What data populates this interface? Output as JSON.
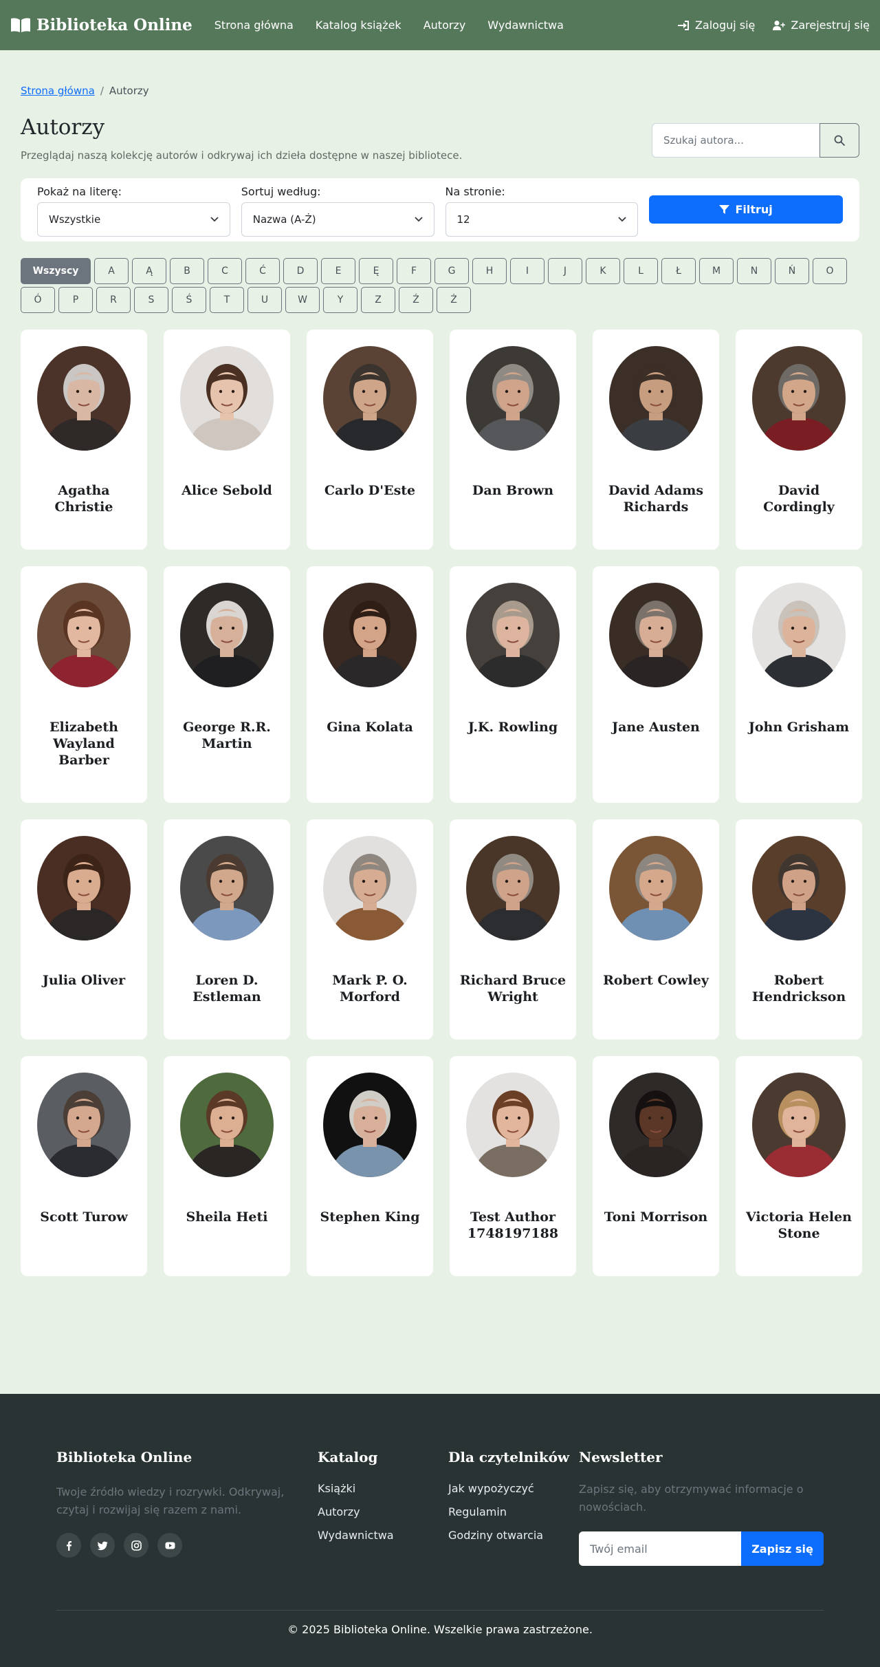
{
  "navbar": {
    "brand": "Biblioteka Online",
    "brand_icon": "book-open-icon",
    "links": [
      "Strona główna",
      "Katalog książek",
      "Autorzy",
      "Wydawnictwa"
    ],
    "login": "Zaloguj się",
    "register": "Zarejestruj się",
    "bg_color": "#55785a"
  },
  "breadcrumb": {
    "home": "Strona główna",
    "separator": "/",
    "current": "Autorzy"
  },
  "page": {
    "title": "Autorzy",
    "subtitle": "Przeglądaj naszą kolekcję autorów i odkrywaj ich dzieła dostępne w naszej bibliotece.",
    "search_placeholder": "Szukaj autora..."
  },
  "filters": {
    "letter_label": "Pokaż na literę:",
    "letter_value": "Wszystkie",
    "sort_label": "Sortuj według:",
    "sort_value": "Nazwa (A-Ż)",
    "per_page_label": "Na stronie:",
    "per_page_value": "12",
    "submit": "Filtruj",
    "accent_color": "#0d6efd"
  },
  "letters": {
    "all": "Wszyscy",
    "items": [
      "A",
      "Ą",
      "B",
      "C",
      "Ć",
      "D",
      "E",
      "Ę",
      "F",
      "G",
      "H",
      "I",
      "J",
      "K",
      "L",
      "Ł",
      "M",
      "N",
      "Ń",
      "O",
      "Ó",
      "P",
      "R",
      "S",
      "Ś",
      "T",
      "U",
      "W",
      "Y",
      "Z",
      "Ź",
      "Ż"
    ]
  },
  "authors": [
    {
      "name": "Agatha Christie",
      "skin": "#d8b8a4",
      "hair": "#c9c6c3",
      "bg": "#4b332a",
      "cloth": "#2f2a28"
    },
    {
      "name": "Alice Sebold",
      "skin": "#e6c3ad",
      "hair": "#4a3022",
      "bg": "#e2dedb",
      "cloth": "#cfc7bf"
    },
    {
      "name": "Carlo D'Este",
      "skin": "#cfa58a",
      "hair": "#3a332e",
      "bg": "#5a4334",
      "cloth": "#27292d"
    },
    {
      "name": "Dan Brown",
      "skin": "#cfa48a",
      "hair": "#8f8a84",
      "bg": "#3d3a36",
      "cloth": "#55575a"
    },
    {
      "name": "David Adams Richards",
      "skin": "#c79d80",
      "hair": "#3b2f27",
      "bg": "#3b2f27",
      "cloth": "#3a3d41"
    },
    {
      "name": "David Cordingly",
      "skin": "#d1a689",
      "hair": "#6e6a66",
      "bg": "#4d3a2f",
      "cloth": "#7b1e24"
    },
    {
      "name": "Elizabeth Wayland Barber",
      "skin": "#e2b9a0",
      "hair": "#5a3524",
      "bg": "#6b4c3a",
      "cloth": "#8d2430"
    },
    {
      "name": "George R.R. Martin",
      "skin": "#d7b09a",
      "hair": "#d9d6d2",
      "bg": "#2e2a27",
      "cloth": "#1f1f22"
    },
    {
      "name": "Gina Kolata",
      "skin": "#d4a488",
      "hair": "#2e1e16",
      "bg": "#3a2a22",
      "cloth": "#2a2828"
    },
    {
      "name": "J.K. Rowling",
      "skin": "#ddb59f",
      "hair": "#a89a8c",
      "bg": "#45403b",
      "cloth": "#2d2c2c"
    },
    {
      "name": "Jane Austen",
      "skin": "#d7ae95",
      "hair": "#7a726b",
      "bg": "#3a2d26",
      "cloth": "#2a2424"
    },
    {
      "name": "John Grisham",
      "skin": "#dcb49b",
      "hair": "#c8c2ba",
      "bg": "#e4e2e0",
      "cloth": "#2c2f33"
    },
    {
      "name": "Julia Oliver",
      "skin": "#d9ab8f",
      "hair": "#3c2418",
      "bg": "#4a2e24",
      "cloth": "#2b2727"
    },
    {
      "name": "Loren D. Estleman",
      "skin": "#d2a88c",
      "hair": "#4a3a30",
      "bg": "#4a4a4a",
      "cloth": "#7d98bd"
    },
    {
      "name": "Mark P. O. Morford",
      "skin": "#d6ac92",
      "hair": "#8d8780",
      "bg": "#e2e0de",
      "cloth": "#8a5a36"
    },
    {
      "name": "Richard Bruce Wright",
      "skin": "#cfa389",
      "hair": "#908a83",
      "bg": "#4a3628",
      "cloth": "#2b2d30"
    },
    {
      "name": "Robert Cowley",
      "skin": "#d5a88c",
      "hair": "#8c8680",
      "bg": "#7a5636",
      "cloth": "#6f8fb3"
    },
    {
      "name": "Robert Hendrickson",
      "skin": "#cfa287",
      "hair": "#3f3630",
      "bg": "#5a3e2c",
      "cloth": "#2c3442"
    },
    {
      "name": "Scott Turow",
      "skin": "#d4a88e",
      "hair": "#4a3e36",
      "bg": "#5a5e63",
      "cloth": "#2a2c31"
    },
    {
      "name": "Sheila Heti",
      "skin": "#dcae92",
      "hair": "#5a3a26",
      "bg": "#4f6b3e",
      "cloth": "#2a2624"
    },
    {
      "name": "Stephen King",
      "skin": "#d8b09a",
      "hair": "#d0ccc6",
      "bg": "#111111",
      "cloth": "#7a93ad"
    },
    {
      "name": "Test Author 1748197188",
      "skin": "#e2b69c",
      "hair": "#6b3f25",
      "bg": "#e4e2e0",
      "cloth": "#7a6e63"
    },
    {
      "name": "Toni Morrison",
      "skin": "#5a3726",
      "hair": "#151111",
      "bg": "#2e2a28",
      "cloth": "#2a2523"
    },
    {
      "name": "Victoria Helen Stone",
      "skin": "#e0b39b",
      "hair": "#b88f5f",
      "bg": "#4a3a30",
      "cloth": "#9a2c34"
    }
  ],
  "footer": {
    "about_title": "Biblioteka Online",
    "about_text": "Twoje źródło wiedzy i rozrywki. Odkrywaj, czytaj i rozwijaj się razem z nami.",
    "socials": [
      "facebook-icon",
      "twitter-icon",
      "instagram-icon",
      "youtube-icon"
    ],
    "catalog_title": "Katalog",
    "catalog_links": [
      "Książki",
      "Autorzy",
      "Wydawnictwa"
    ],
    "readers_title": "Dla czytelników",
    "readers_links": [
      "Jak wypożyczyć",
      "Regulamin",
      "Godziny otwarcia"
    ],
    "newsletter_title": "Newsletter",
    "newsletter_text": "Zapisz się, aby otrzymywać informacje o nowościach.",
    "newsletter_placeholder": "Twój email",
    "newsletter_button": "Zapisz się",
    "copyright": "© 2025 Biblioteka Online. Wszelkie prawa zastrzeżone."
  }
}
